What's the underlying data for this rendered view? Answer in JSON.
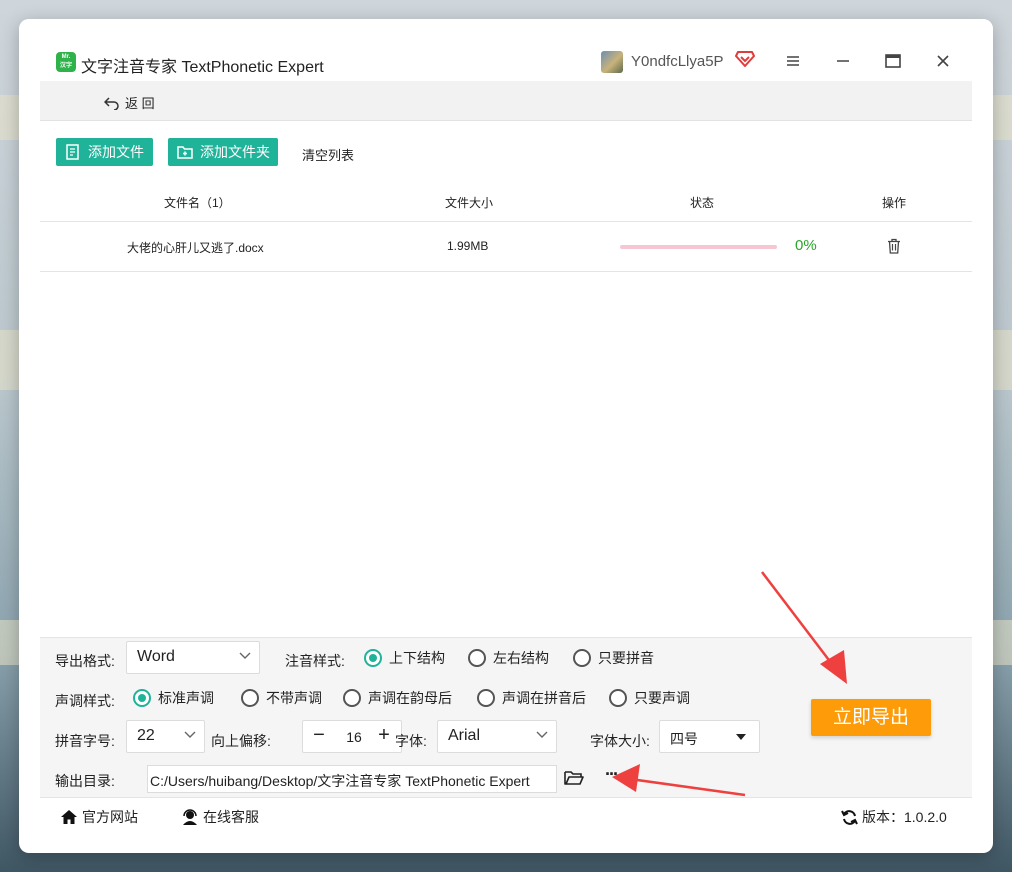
{
  "window": {
    "title": "文字注音专家 TextPhonetic Expert",
    "logo_text_top": "Mr.",
    "logo_text_bottom": "汉字",
    "username": "Y0ndfcLlya5P"
  },
  "nav": {
    "back_label": "返 回"
  },
  "toolbar": {
    "add_file_label": "添加文件",
    "add_folder_label": "添加文件夹",
    "clear_list_label": "清空列表"
  },
  "table": {
    "headers": {
      "name": "文件名（1）",
      "size": "文件大小",
      "status": "状态",
      "action": "操作"
    },
    "rows": [
      {
        "name": "大佬的心肝儿又逃了.docx",
        "size": "1.99MB",
        "progress": 0,
        "progress_text": "0%"
      }
    ]
  },
  "settings": {
    "export_format_label": "导出格式:",
    "export_format_value": "Word",
    "annotation_style_label": "注音样式:",
    "annotation_options": [
      "上下结构",
      "左右结构",
      "只要拼音"
    ],
    "annotation_selected": 0,
    "tone_style_label": "声调样式:",
    "tone_options": [
      "标准声调",
      "不带声调",
      "声调在韵母后",
      "声调在拼音后",
      "只要声调"
    ],
    "tone_selected": 0,
    "pinyin_size_label": "拼音字号:",
    "pinyin_size_value": "22",
    "offset_label": "向上偏移:",
    "offset_value": "16",
    "offset_minus": "−",
    "offset_plus": "+",
    "font_label": "字体:",
    "font_value": "Arial",
    "font_size_label": "字体大小:",
    "font_size_value": "四号",
    "output_dir_label": "输出目录:",
    "output_dir_value": "C:/Users/huibang/Desktop/文字注音专家 TextPhonetic Expert",
    "more_label": "···"
  },
  "export_button_label": "立即导出",
  "footer": {
    "website_label": "官方网站",
    "support_label": "在线客服",
    "version_label": "版本：1.0.2.0"
  },
  "colors": {
    "accent": "#1fb39a",
    "export": "#fd9c08",
    "arrow": "#ef4040",
    "progress_text": "#2aa52a"
  }
}
